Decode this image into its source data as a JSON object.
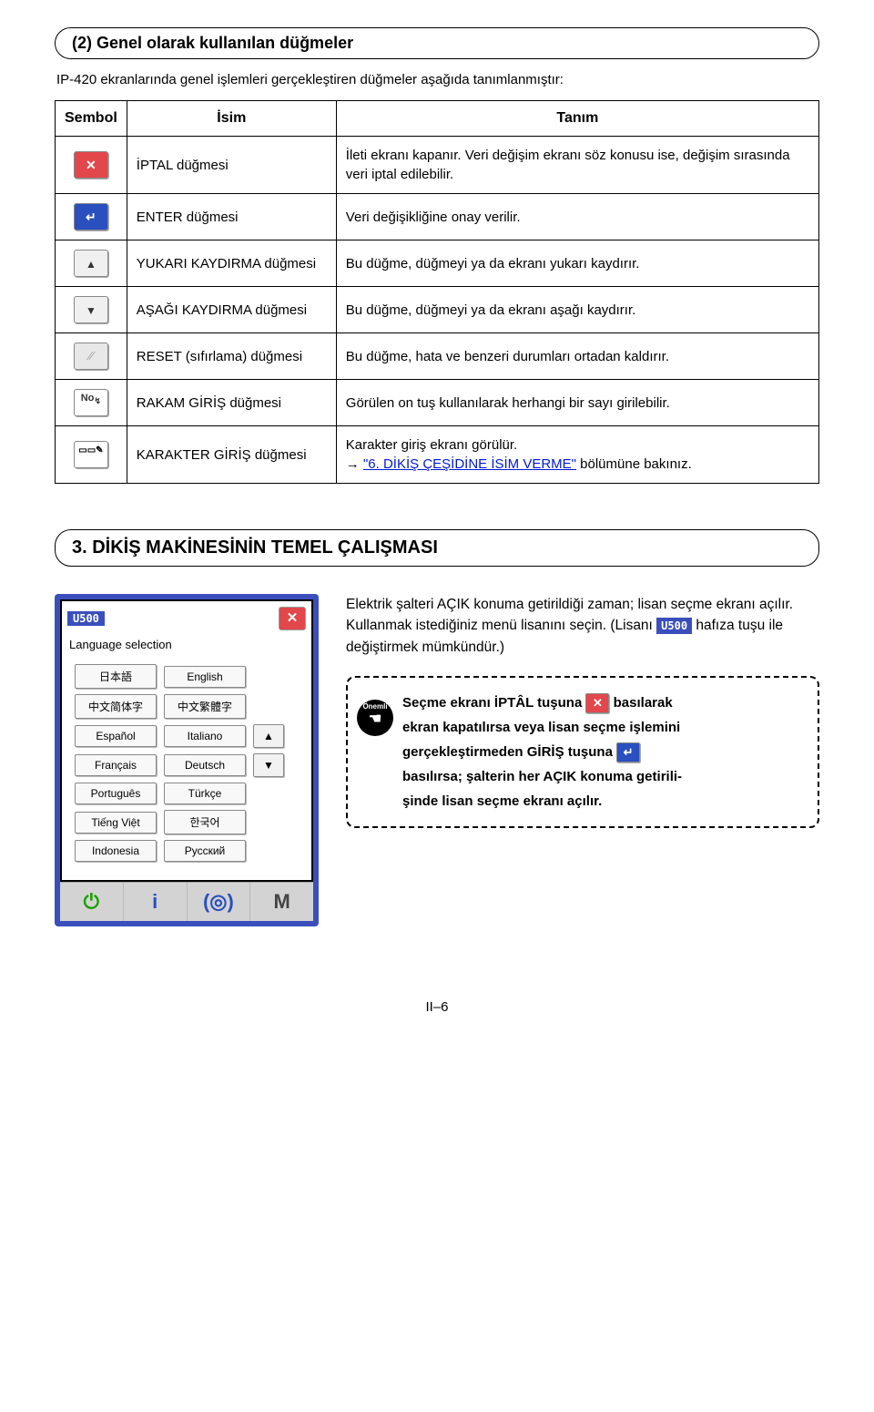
{
  "section2": {
    "title": "(2) Genel olarak kullanılan düğmeler",
    "intro": "IP-420 ekranlarında genel işlemleri gerçekleştiren düğmeler aşağıda tanımlanmıştır:",
    "headers": {
      "symbol": "Sembol",
      "name": "İsim",
      "desc": "Tanım"
    },
    "rows": [
      {
        "name": "İPTAL düğmesi",
        "desc": "İleti ekranı kapanır. Veri değişim ekranı söz konusu ise, değişim sırasında veri iptal edilebilir."
      },
      {
        "name": "ENTER düğmesi",
        "desc": "Veri değişikliğine onay verilir."
      },
      {
        "name": "YUKARI KAYDIRMA düğmesi",
        "desc": "Bu düğme, düğmeyi ya da ekranı yukarı kaydırır."
      },
      {
        "name": "AŞAĞI KAYDIRMA düğmesi",
        "desc": "Bu düğme, düğmeyi ya da ekranı aşağı kaydırır."
      },
      {
        "name": "RESET (sıfırlama) düğmesi",
        "desc": "Bu düğme, hata ve benzeri durumları ortadan kaldırır."
      },
      {
        "name": "RAKAM GİRİŞ düğmesi",
        "desc": "Görülen on tuş kullanılarak herhangi bir sayı girilebilir."
      },
      {
        "name": "KARAKTER GİRİŞ düğmesi",
        "desc_pre": "Karakter giriş ekranı görülür.",
        "desc_arrow": "→ ",
        "desc_link": "\"6. DİKİŞ ÇEŞİDİNE İSİM VERME\"",
        "desc_post": " bölümüne bakınız."
      }
    ]
  },
  "section3": {
    "title": "3. DİKİŞ MAKİNESİNİN TEMEL ÇALIŞMASI",
    "screenshot": {
      "u500": "U500",
      "language_selection": "Language selection",
      "langs": [
        "日本語",
        "English",
        "中文简体字",
        "中文繁體字",
        "Español",
        "Italiano",
        "Français",
        "Deutsch",
        "Português",
        "Türkçe",
        "Tiếng Việt",
        "한국어",
        "Indonesia",
        "Русский"
      ]
    },
    "para": {
      "p1a": "Elektrik şalteri AÇIK konuma getirildiği zaman; lisan seçme ekranı açılır. Kullanmak istediğiniz menü lisanını seçin. (Lisanı ",
      "p1_u500": "U500",
      "p1b": " hafıza tuşu ile değiştirmek mümkündür.)"
    },
    "note": {
      "badge": "Önemli",
      "l1a": "Seçme ekranı İPTÂL tuşuna ",
      "l1b": " basılarak",
      "l2": "ekran kapatılırsa veya lisan seçme işlemini",
      "l3a": "gerçekleştirmeden GİRİŞ tuşuna ",
      "l4": "basılırsa; şalterin her AÇIK konuma getirili-",
      "l5": "şinde lisan seçme ekranı açılır."
    }
  },
  "footer": "II–6"
}
